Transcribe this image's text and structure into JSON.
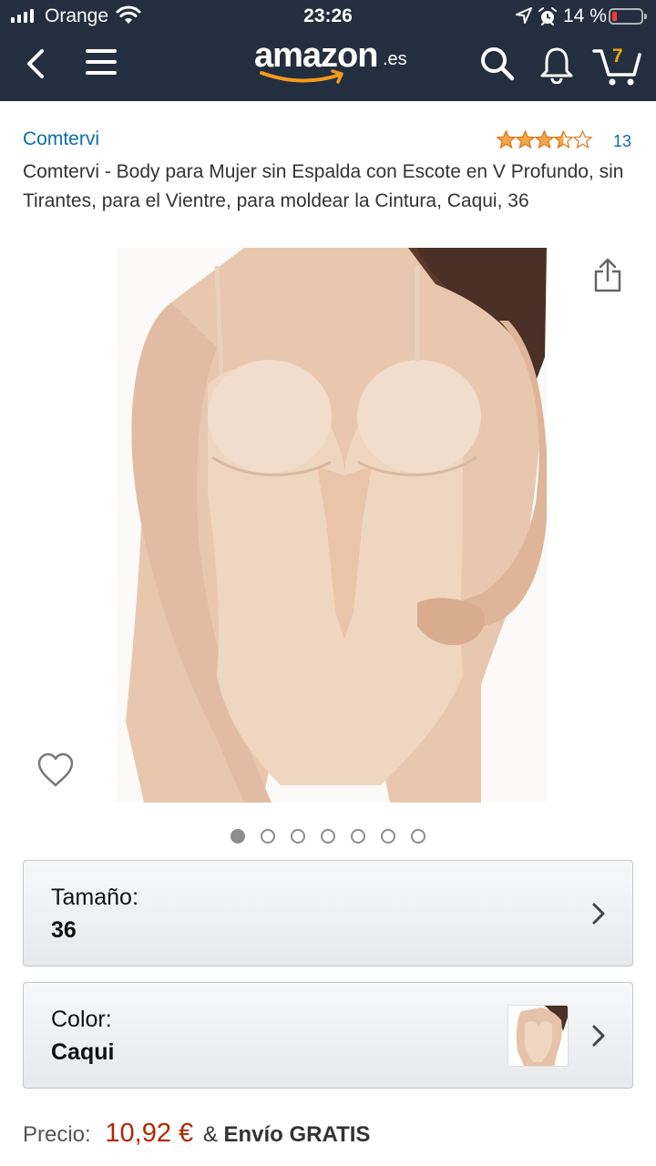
{
  "status_bar": {
    "carrier": "Orange",
    "time": "23:26",
    "battery_percent": "14 %"
  },
  "nav": {
    "logo_text": "amazon",
    "logo_tld": ".es",
    "cart_count": "7",
    "icons": [
      "back-icon",
      "menu-icon",
      "search-icon",
      "bell-icon",
      "cart-icon"
    ]
  },
  "product": {
    "brand": "Comtervi",
    "rating": 3.5,
    "rating_max": 5,
    "review_count": "13",
    "title": "Comtervi - Body para Mujer sin Espalda con Escote en V Profundo, sin Tirantes, para el Vientre, para moldear la Cintura, Caqui, 36",
    "image_count": 7,
    "active_image": 1
  },
  "options": {
    "size": {
      "label": "Tamaño:",
      "value": "36"
    },
    "color": {
      "label": "Color:",
      "value": "Caqui"
    }
  },
  "price": {
    "label": "Precio:",
    "value": "10,92 €",
    "amp": "&",
    "shipping": "Envío GRATIS"
  },
  "colors": {
    "header_bg": "#232f3e",
    "link": "#0b6ea6",
    "price": "#b12704",
    "star": "#f3a847",
    "cart_badge": "#f0a800"
  }
}
